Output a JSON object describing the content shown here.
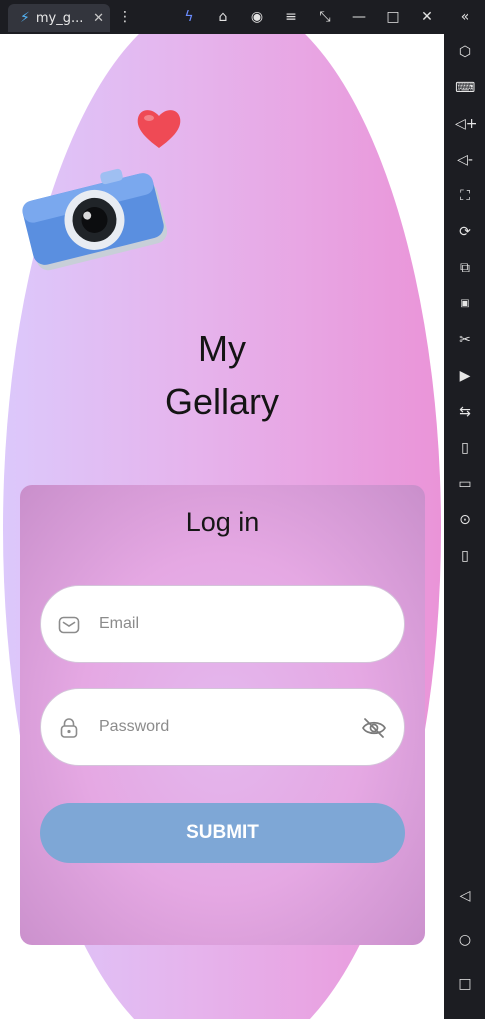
{
  "window": {
    "tab_title": "my_g...",
    "tab_close": "✕"
  },
  "app": {
    "title_line1": "My",
    "title_line2": "Gellary"
  },
  "login": {
    "heading": "Log in",
    "email_placeholder": "Email",
    "password_placeholder": "Password",
    "submit_label": "SUBMIT"
  },
  "colors": {
    "gradient_left": "#dcc8fb",
    "gradient_right": "#ea94d8",
    "submit_bg": "#7ea7d6",
    "camera_body": "#5a8fe0",
    "heart": "#ef4a55"
  }
}
